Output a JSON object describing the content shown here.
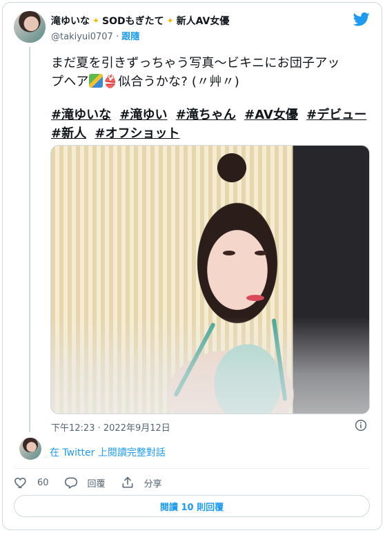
{
  "user": {
    "display_name_part1": "滝ゆいな",
    "display_name_part2": "SODもぎたて",
    "display_name_part3": "新人AV女優",
    "handle": "@takiyui0707",
    "separator": "·",
    "follow_label": "跟隨"
  },
  "tweet": {
    "text_line1": "まだ夏を引きずっちゃう写真〜ビキニにお団子アッ",
    "text_line2_prefix": "プヘア",
    "text_line2_suffix": "似合うかな? (〃艸〃)",
    "hashtags": [
      "#滝ゆいな",
      "#滝ゆい",
      "#滝ちゃん",
      "#AV女優",
      "#デビュー",
      "#新人",
      "#オフショット"
    ],
    "timestamp": "下午12:23 · 2022年9月12日"
  },
  "conversation": {
    "link_label": "在 Twitter 上閱讀完整對話"
  },
  "actions": {
    "like_count": "60",
    "reply_label": "回覆",
    "share_label": "分享"
  },
  "footer": {
    "read_replies_label": "閱讀 10 則回覆"
  },
  "colors": {
    "accent": "#1d9bf0",
    "text": "#0f1419",
    "secondary": "#536471",
    "border": "#cfd9de"
  },
  "icons": [
    "twitter-bird-icon",
    "star-emoji-icon",
    "info-icon",
    "heart-icon",
    "reply-icon",
    "share-icon"
  ]
}
